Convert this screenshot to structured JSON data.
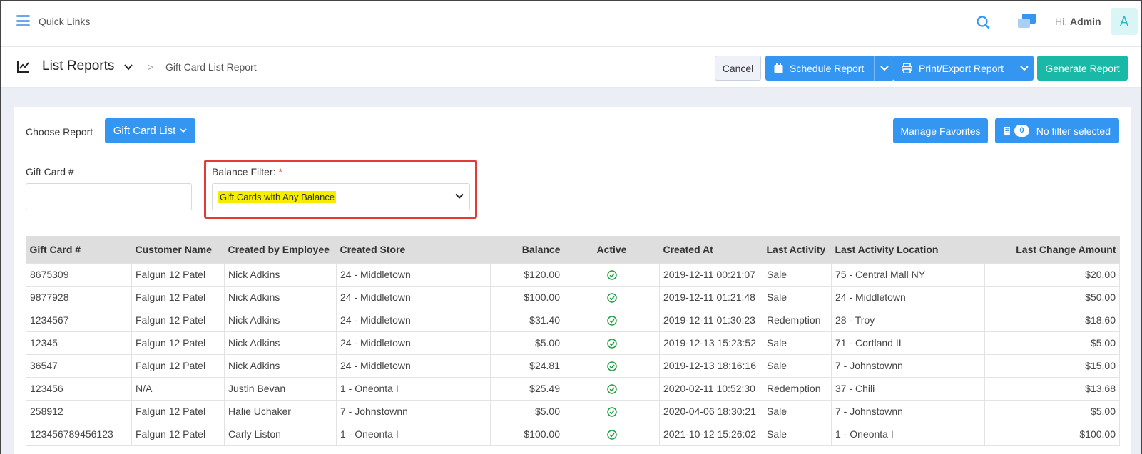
{
  "topbar": {
    "quick_links": "Quick Links",
    "greeting_prefix": "Hi,",
    "greeting_name": "Admin",
    "avatar_letter": "A"
  },
  "header": {
    "title": "List Reports",
    "breadcrumb": "Gift Card List Report",
    "cancel_label": "Cancel",
    "schedule_label": "Schedule Report",
    "print_label": "Print/Export Report",
    "generate_label": "Generate Report"
  },
  "filters": {
    "choose_report_label": "Choose Report",
    "report_selected": "Gift Card List",
    "manage_favorites_label": "Manage Favorites",
    "filter_count": "0",
    "no_filter_label": "No filter selected",
    "gift_card_label": "Gift Card #",
    "gift_card_value": "",
    "balance_filter_label": "Balance Filter:",
    "balance_filter_required": "*",
    "balance_filter_value": "Gift Cards with Any Balance"
  },
  "table": {
    "columns": [
      "Gift Card #",
      "Customer Name",
      "Created by Employee",
      "Created Store",
      "Balance",
      "Active",
      "Created At",
      "Last Activity",
      "Last Activity Location",
      "Last Change Amount"
    ],
    "rows": [
      [
        "8675309",
        "Falgun 12 Patel",
        "Nick Adkins",
        "24 - Middletown",
        "$120.00",
        "active",
        "2019-12-11 00:21:07",
        "Sale",
        "75 - Central Mall NY",
        "$20.00"
      ],
      [
        "9877928",
        "Falgun 12 Patel",
        "Nick Adkins",
        "24 - Middletown",
        "$100.00",
        "active",
        "2019-12-11 01:21:48",
        "Sale",
        "24 - Middletown",
        "$50.00"
      ],
      [
        "1234567",
        "Falgun 12 Patel",
        "Nick Adkins",
        "24 - Middletown",
        "$31.40",
        "active",
        "2019-12-11 01:30:23",
        "Redemption",
        "28 - Troy",
        "$18.60"
      ],
      [
        "12345",
        "Falgun 12 Patel",
        "Nick Adkins",
        "24 - Middletown",
        "$5.00",
        "active",
        "2019-12-13 15:23:52",
        "Sale",
        "71 - Cortland II",
        "$5.00"
      ],
      [
        "36547",
        "Falgun 12 Patel",
        "Nick Adkins",
        "24 - Middletown",
        "$24.81",
        "active",
        "2019-12-13 18:16:16",
        "Sale",
        "7 - Johnstownn",
        "$15.00"
      ],
      [
        "123456",
        "N/A",
        "Justin Bevan",
        "1 - Oneonta I",
        "$25.49",
        "active",
        "2020-02-11 10:52:30",
        "Redemption",
        "37 - Chili",
        "$13.68"
      ],
      [
        "258912",
        "Falgun 12 Patel",
        "Halie Uchaker",
        "7 - Johnstownn",
        "$5.00",
        "active",
        "2020-04-06 18:30:21",
        "Sale",
        "7 - Johnstownn",
        "$5.00"
      ],
      [
        "123456789456123",
        "Falgun 12 Patel",
        "Carly Liston",
        "1 - Oneonta I",
        "$100.00",
        "active",
        "2021-10-12 15:26:02",
        "Sale",
        "1 - Oneonta I",
        "$100.00"
      ]
    ]
  },
  "colors": {
    "primary": "#3596f2",
    "success": "#1ab8a6",
    "highlight_border": "#e53935",
    "highlight_bg": "#f5ee00"
  }
}
